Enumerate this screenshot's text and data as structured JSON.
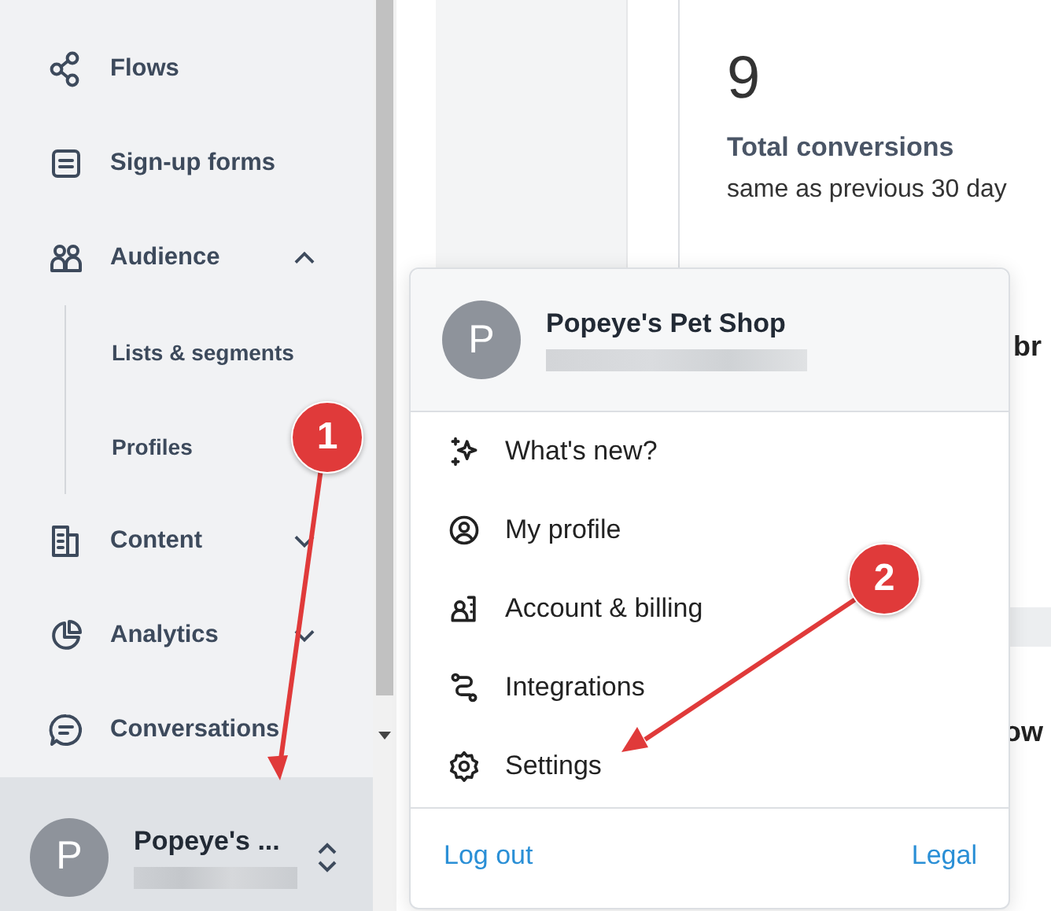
{
  "sidebar": {
    "items": [
      {
        "label": "Flows"
      },
      {
        "label": "Sign-up forms"
      },
      {
        "label": "Audience",
        "expanded": true,
        "children": [
          {
            "label": "Lists & segments"
          },
          {
            "label": "Profiles"
          }
        ]
      },
      {
        "label": "Content",
        "expanded": false
      },
      {
        "label": "Analytics",
        "expanded": false
      },
      {
        "label": "Conversations"
      }
    ]
  },
  "account": {
    "name": "Popeye's ...",
    "initial": "P"
  },
  "main": {
    "stat": {
      "value": "9",
      "label": "Total conversions",
      "comparison": "same as previous 30 day"
    },
    "fragments": [
      "br",
      "ow"
    ]
  },
  "account_menu": {
    "initial": "P",
    "name": "Popeye's Pet Shop",
    "items": [
      {
        "label": "What's new?"
      },
      {
        "label": "My profile"
      },
      {
        "label": "Account & billing"
      },
      {
        "label": "Integrations"
      },
      {
        "label": "Settings"
      }
    ],
    "logout": "Log out",
    "legal": "Legal"
  },
  "annotations": [
    {
      "label": "1"
    },
    {
      "label": "2"
    }
  ]
}
